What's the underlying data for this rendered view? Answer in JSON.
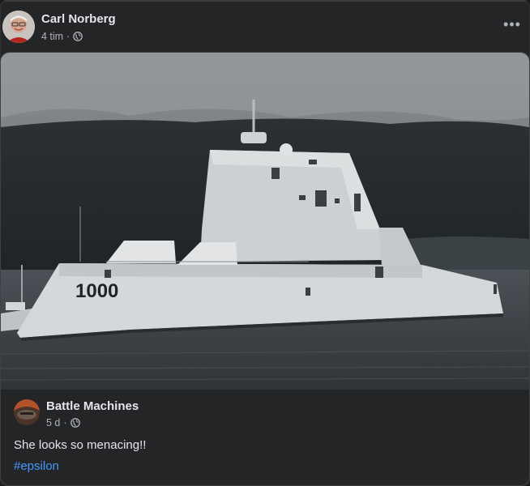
{
  "post": {
    "author": "Carl Norberg",
    "time": "4 tim",
    "separator": "·",
    "privacy_icon": "globe-icon",
    "more_icon": "more-options-icon",
    "more_label": "•••"
  },
  "shared": {
    "image_alt": "Zumwalt-class destroyer 1000 at sea under a dark cloudy sky",
    "hull_number": "1000",
    "author": "Battle Machines",
    "time": "5 d",
    "separator": "·",
    "privacy_icon": "globe-icon",
    "text": "She looks so menacing!!",
    "hashtag": "#epsilon"
  },
  "colors": {
    "background": "#242526",
    "text_primary": "#e4e6eb",
    "text_secondary": "#b0b3b8",
    "link": "#4599ff"
  }
}
